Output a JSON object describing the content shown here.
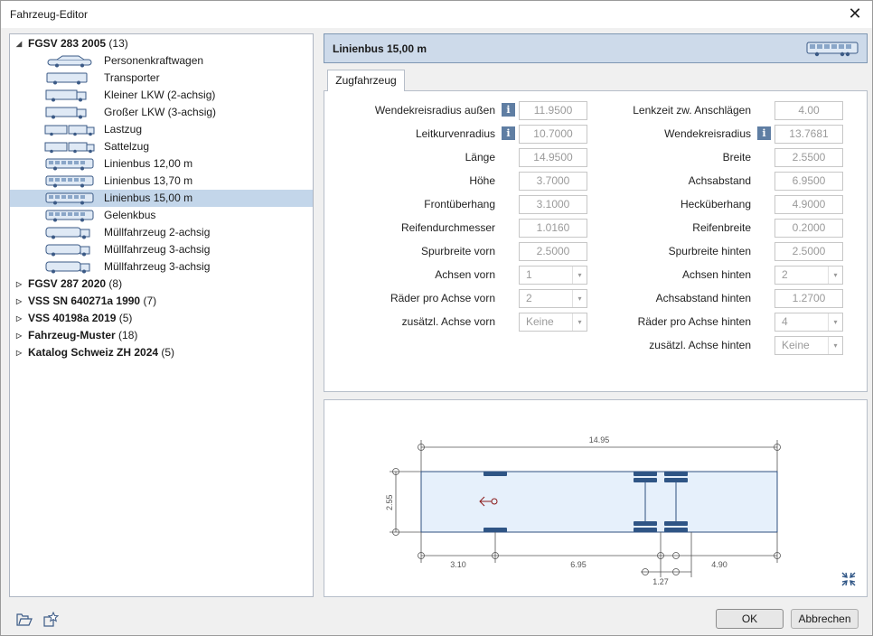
{
  "window": {
    "title": "Fahrzeug-Editor",
    "close": "✕"
  },
  "tree": {
    "groups": [
      {
        "name": "FGSV 283 2005",
        "count": "(13)",
        "expanded": true,
        "items": [
          "Personenkraftwagen",
          "Transporter",
          "Kleiner LKW (2-achsig)",
          "Großer LKW (3-achsig)",
          "Lastzug",
          "Sattelzug",
          "Linienbus 12,00 m",
          "Linienbus 13,70 m",
          "Linienbus 15,00 m",
          "Gelenkbus",
          "Müllfahrzeug 2-achsig",
          "Müllfahrzeug 3-achsig",
          "Müllfahrzeug 3-achsig"
        ]
      },
      {
        "name": "FGSV 287 2020",
        "count": "(8)",
        "expanded": false
      },
      {
        "name": "VSS SN 640271a 1990",
        "count": "(7)",
        "expanded": false
      },
      {
        "name": "VSS 40198a 2019",
        "count": "(5)",
        "expanded": false
      },
      {
        "name": "Fahrzeug-Muster",
        "count": "(18)",
        "expanded": false
      },
      {
        "name": "Katalog Schweiz ZH 2024",
        "count": "(5)",
        "expanded": false
      }
    ],
    "expanded_glyph": "◢",
    "collapsed_glyph": "▷",
    "selected": "Linienbus 15,00 m"
  },
  "header": {
    "title": "Linienbus 15,00 m",
    "icon": "bus-icon"
  },
  "tab": {
    "label": "Zugfahrzeug"
  },
  "form": {
    "left": [
      {
        "label": "Wendekreisradius außen",
        "value": "11.9500",
        "info": true
      },
      {
        "label": "Leitkurvenradius",
        "value": "10.7000",
        "info": true
      },
      {
        "label": "Länge",
        "value": "14.9500"
      },
      {
        "label": "Höhe",
        "value": "3.7000"
      },
      {
        "label": "Frontüberhang",
        "value": "3.1000"
      },
      {
        "label": "Reifendurchmesser",
        "value": "1.0160"
      },
      {
        "label": "Spurbreite vorn",
        "value": "2.5000"
      },
      {
        "label": "Achsen vorn",
        "value": "1",
        "dropdown": true
      },
      {
        "label": "Räder pro Achse vorn",
        "value": "2",
        "dropdown": true
      },
      {
        "label": "zusätzl. Achse vorn",
        "value": "Keine",
        "dropdown": true
      }
    ],
    "right": [
      {
        "label": "Lenkzeit zw. Anschlägen",
        "value": "4.00"
      },
      {
        "label": "Wendekreisradius",
        "value": "13.7681",
        "info": true
      },
      {
        "label": "Breite",
        "value": "2.5500"
      },
      {
        "label": "Achsabstand",
        "value": "6.9500"
      },
      {
        "label": "Hecküberhang",
        "value": "4.9000"
      },
      {
        "label": "Reifenbreite",
        "value": "0.2000"
      },
      {
        "label": "Spurbreite hinten",
        "value": "2.5000"
      },
      {
        "label": "Achsen hinten",
        "value": "2",
        "dropdown": true
      },
      {
        "label": "Achsabstand hinten",
        "value": "1.2700"
      },
      {
        "label": "Räder pro Achse hinten",
        "value": "4",
        "dropdown": true
      },
      {
        "label": "zusätzl. Achse hinten",
        "value": "Keine",
        "dropdown": true
      }
    ],
    "info_glyph": "i",
    "dropdown_glyph": "▾"
  },
  "diagram": {
    "length": "14.95",
    "width": "2.55",
    "front_overhang": "3.10",
    "wheelbase": "6.95",
    "rear_axle_spacing": "1.27",
    "rear_overhang": "4.90",
    "colors": {
      "body_fill": "#e6f0fb",
      "body_stroke": "#2f4f7f",
      "wheel": "#2f5585",
      "dim": "#555555",
      "arrow": "#8b1a1a"
    }
  },
  "footer": {
    "ok": "OK",
    "cancel": "Abbrechen"
  }
}
